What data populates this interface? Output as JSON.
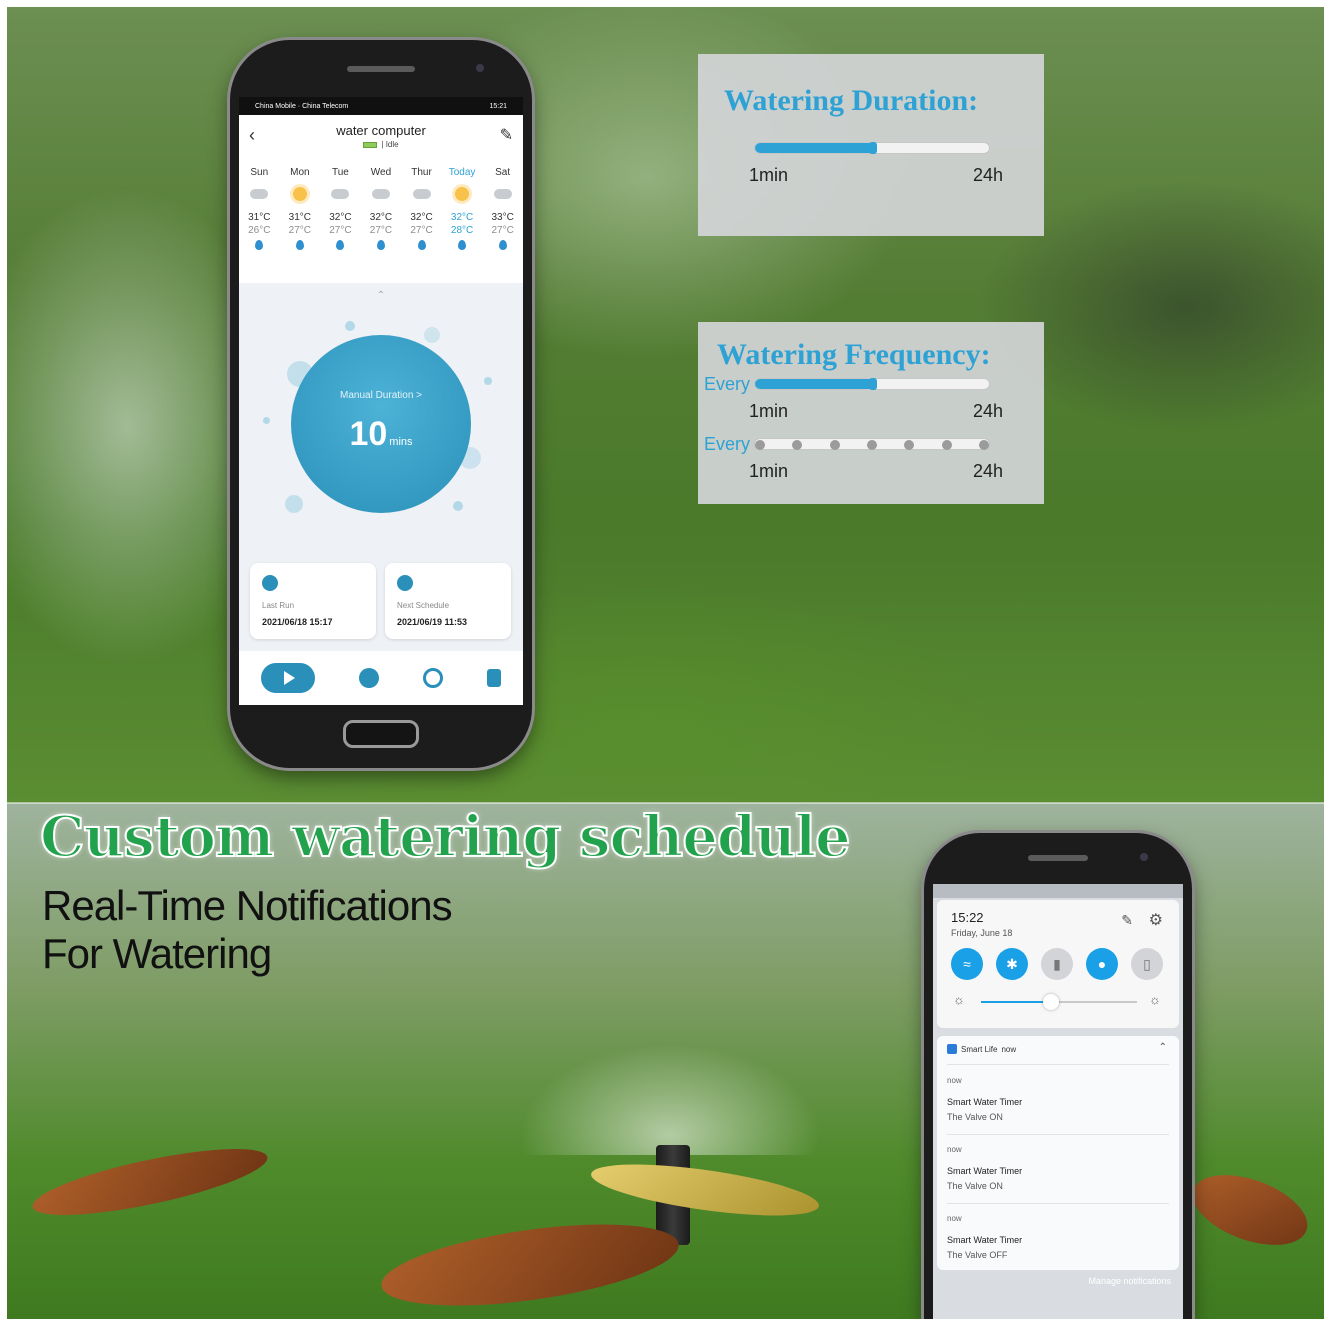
{
  "phone1": {
    "status_left": "China Mobile · China Telecom",
    "status_time": "15:21",
    "title": "water computer",
    "status": "| Idle",
    "forecast": [
      {
        "day": "Sun",
        "weather": "cloud",
        "high": "31°C",
        "low": "26°C"
      },
      {
        "day": "Mon",
        "weather": "sun",
        "high": "31°C",
        "low": "27°C"
      },
      {
        "day": "Tue",
        "weather": "cloud",
        "high": "32°C",
        "low": "27°C"
      },
      {
        "day": "Wed",
        "weather": "cloud",
        "high": "32°C",
        "low": "27°C"
      },
      {
        "day": "Thur",
        "weather": "cloud",
        "high": "32°C",
        "low": "27°C"
      },
      {
        "day": "Today",
        "weather": "sun",
        "high": "32°C",
        "low": "28°C"
      },
      {
        "day": "Sat",
        "weather": "cloud",
        "high": "33°C",
        "low": "27°C"
      }
    ],
    "manual_label": "Manual Duration >",
    "duration_value": "10",
    "duration_unit": "mins",
    "last_run_label": "Last Run",
    "last_run_value": "2021/06/18 15:17",
    "next_schedule_label": "Next Schedule",
    "next_schedule_value": "2021/06/19 11:53",
    "accent": "#2a90b9"
  },
  "duration_panel": {
    "title": "Watering Duration:",
    "min_label": "1min",
    "max_label": "24h",
    "fill_fraction": 0.5
  },
  "frequency_panel": {
    "title": "Watering Frequency:",
    "every_label_1": "Every",
    "every_label_2": "Every",
    "min_label_1": "1min",
    "max_label_1": "24h",
    "min_label_2": "1min",
    "max_label_2": "24h",
    "fill_fraction": 0.5,
    "step_count": 7
  },
  "headline": "Custom watering schedule",
  "subhead_line1": "Real-Time Notifications",
  "subhead_line2": "For Watering",
  "phone2": {
    "time": "15:22",
    "date": "Friday, June 18",
    "brightness_fraction": 0.45,
    "app_name": "Smart Life",
    "app_time": "now",
    "notifications": [
      {
        "time": "now",
        "title": "Smart Water Timer",
        "body": "The Valve ON"
      },
      {
        "time": "now",
        "title": "Smart Water Timer",
        "body": "The Valve ON"
      },
      {
        "time": "now",
        "title": "Smart Water Timer",
        "body": "The  Valve OFF"
      }
    ],
    "manage_label": "Manage notifications"
  },
  "colors": {
    "headline_green": "#23a24d",
    "panel_blue": "#2ea2d4",
    "toggle_blue": "#1aa0e6"
  }
}
